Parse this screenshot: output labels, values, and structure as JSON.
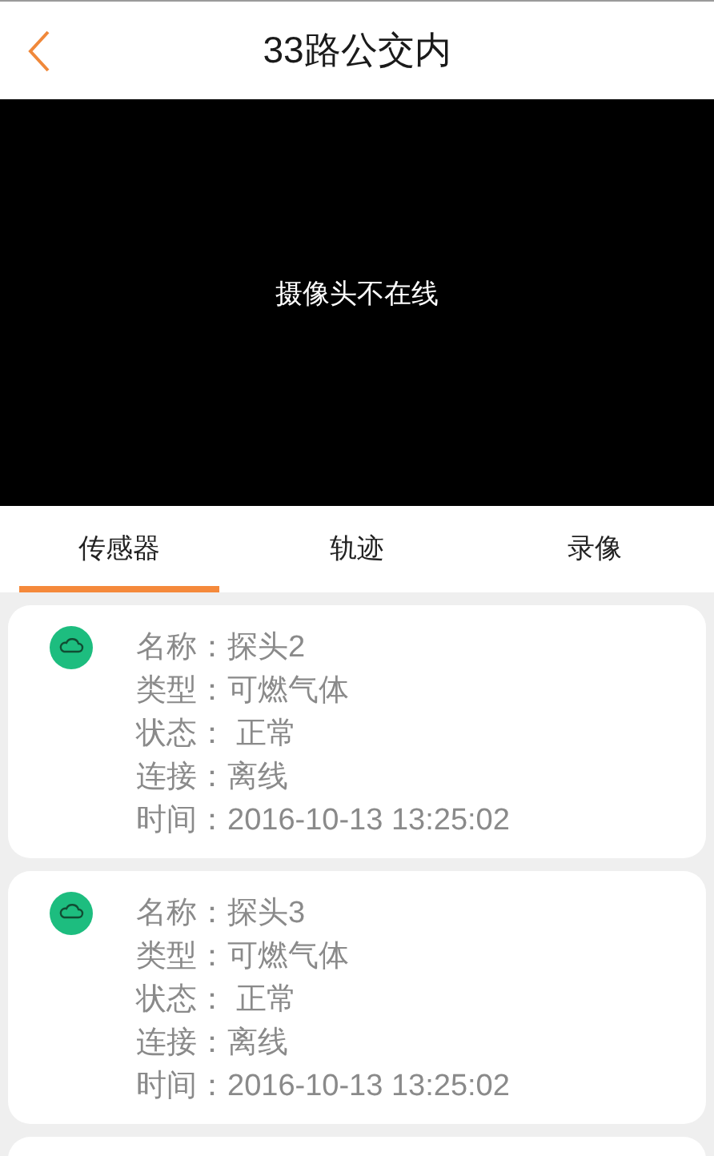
{
  "header": {
    "title": "33路公交内"
  },
  "video": {
    "message": "摄像头不在线"
  },
  "tabs": [
    {
      "label": "传感器",
      "selected": true
    },
    {
      "label": "轨迹",
      "selected": false
    },
    {
      "label": "录像",
      "selected": false
    }
  ],
  "sensors": [
    {
      "lines": [
        "名称：探头2",
        "类型：可燃气体",
        "状态： 正常",
        "连接：离线",
        "时间：2016-10-13 13:25:02"
      ]
    },
    {
      "lines": [
        "名称：探头3",
        "类型：可燃气体",
        "状态： 正常",
        "连接：离线",
        "时间：2016-10-13 13:25:02"
      ]
    }
  ]
}
